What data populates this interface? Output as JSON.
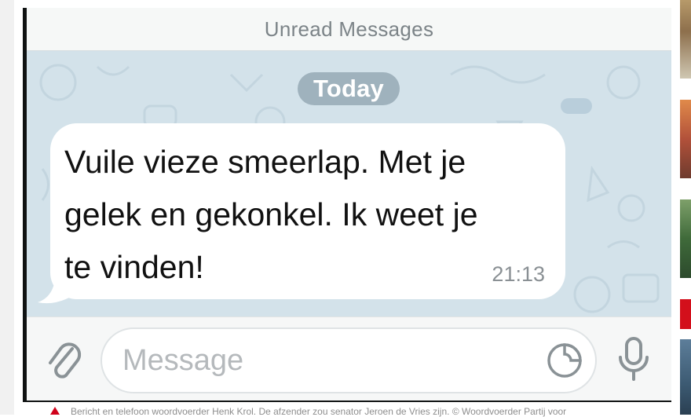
{
  "chat": {
    "unread_banner": "Unread Messages",
    "date_chip": "Today",
    "message": {
      "text": "Vuile vieze smeerlap. Met je\ngelek en gekonkel. Ik weet je\nte vinden!",
      "time": "21:13"
    }
  },
  "composer": {
    "placeholder": "Message",
    "icons": {
      "attach": "paperclip-icon",
      "sticker": "sticker-icon",
      "voice": "microphone-icon"
    }
  },
  "caption": {
    "text": "Bericht en telefoon woordvoerder Henk Krol. De afzender zou senator Jeroen de Vries zijn. © Woordvoerder Partij voor"
  },
  "colors": {
    "chat_background": "#d3e2ea",
    "date_chip": "#9fb2bd",
    "bubble": "#ffffff",
    "caption_icon": "#d0021b"
  }
}
